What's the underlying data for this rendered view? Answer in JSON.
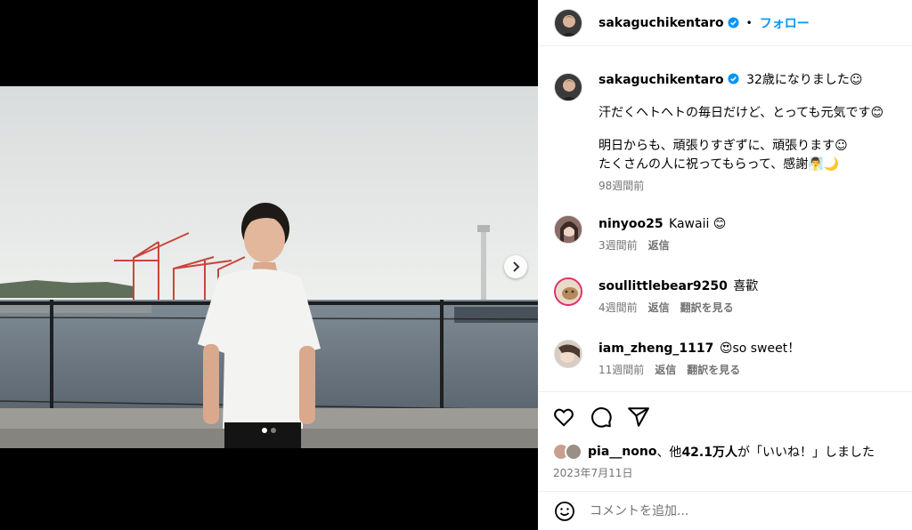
{
  "post": {
    "author": "sakaguchikentaro",
    "follow_label": "フォロー",
    "separator": "•"
  },
  "caption": {
    "author": "sakaguchikentaro",
    "line1": "32歳になりました☺︎",
    "line2": "汗だくヘトヘトの毎日だけど、とっても元気です😊",
    "line3": "明日からも、頑張りすぎずに、頑張ります☺︎",
    "line4": "たくさんの人に祝ってもらって、感謝🧖‍♂️🌙",
    "time": "98週間前"
  },
  "comments": [
    {
      "user": "ninyoo25",
      "text": "Kawaii 😊",
      "time": "3週間前",
      "reply": "返信",
      "translate": ""
    },
    {
      "user": "soullittlebear9250",
      "text": "喜歡",
      "time": "4週間前",
      "reply": "返信",
      "translate": "翻訳を見る"
    },
    {
      "user": "iam_zheng_1117",
      "text": "😍so sweet！",
      "time": "11週間前",
      "reply": "返信",
      "translate": "翻訳を見る"
    }
  ],
  "likes": {
    "user": "pia__nono",
    "rest_a": "、他",
    "count": "42.1万人",
    "rest_b": "が「いいね！」しました"
  },
  "date": "2023年7月11日",
  "comment_input": {
    "placeholder": "コメントを追加..."
  },
  "colors": {
    "accent": "#0095f6",
    "muted": "#737373",
    "divider": "#efefef"
  }
}
